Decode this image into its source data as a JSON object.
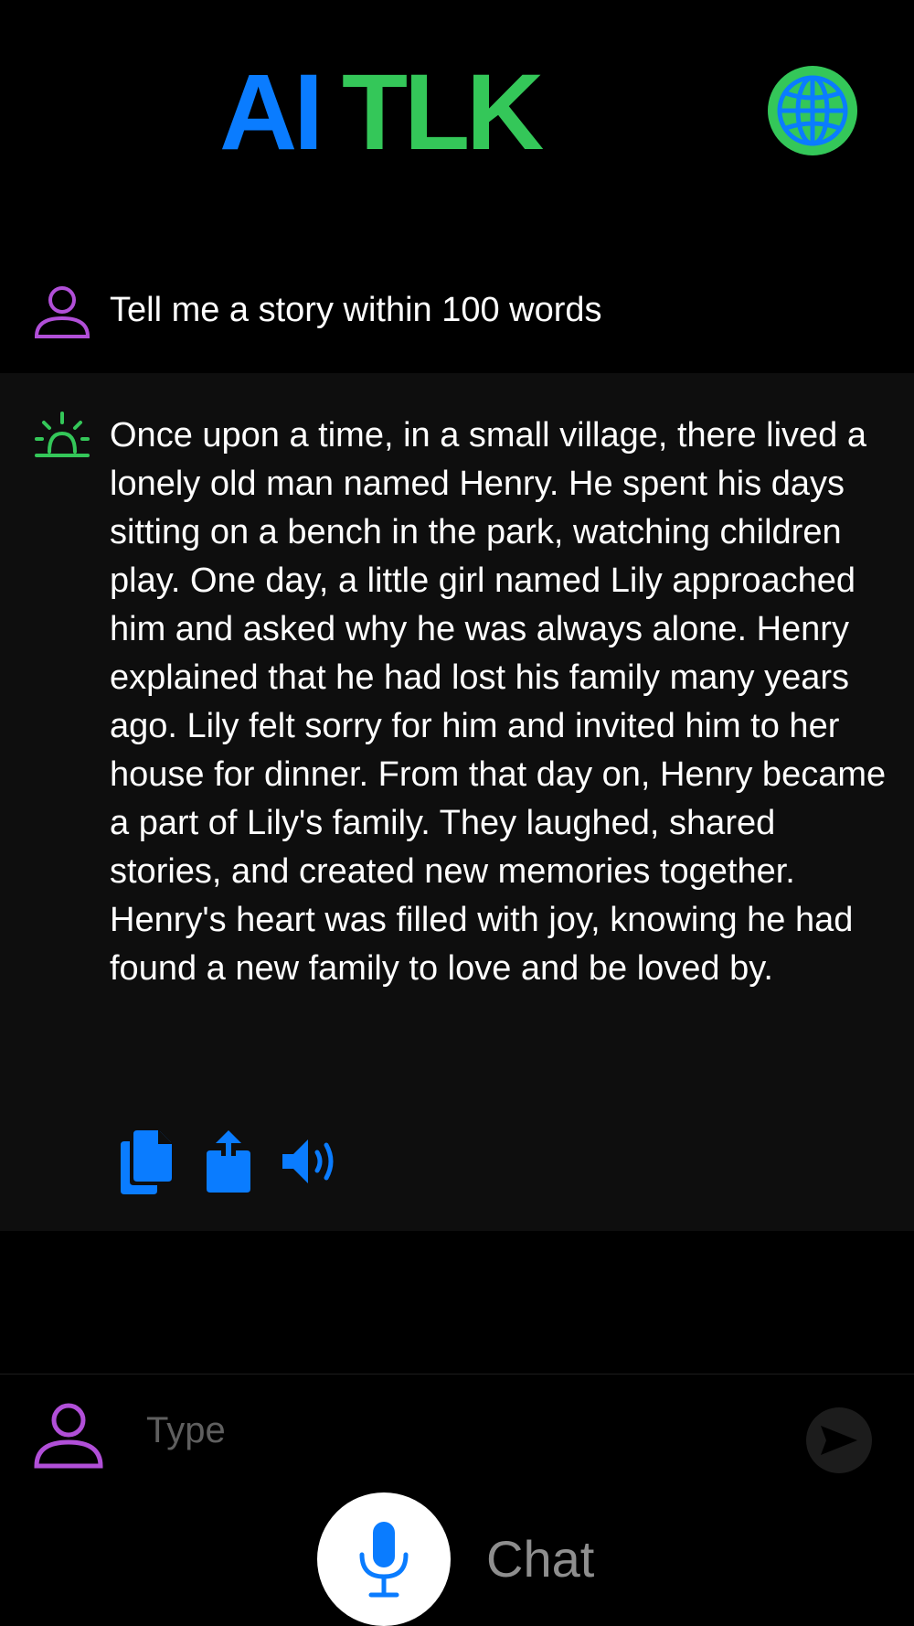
{
  "header": {
    "title_ai": "AI",
    "title_tlk": "TLK",
    "language_icon": "globe-icon"
  },
  "conversation": {
    "user_message": {
      "icon": "person-icon",
      "text": "Tell me a story within 100 words"
    },
    "assistant_message": {
      "icon": "sunrise-icon",
      "text": "Once upon a time, in a small village, there lived a lonely old man named Henry. He spent his days sitting on a bench in the park, watching children play. One day, a little girl named Lily approached him and asked why he was always alone. Henry explained that he had lost his family many years ago. Lily felt sorry for him and invited him to her house for dinner. From that day on, Henry became a part of Lily's family. They laughed, shared stories, and created new memories together. Henry's heart was filled with joy, knowing he had found a new family to love and be loved by.",
      "actions": [
        "copy-icon",
        "share-icon",
        "speaker-icon"
      ]
    }
  },
  "composer": {
    "avatar_icon": "person-icon",
    "placeholder": "Type",
    "send_icon": "send-icon"
  },
  "footer": {
    "mic_icon": "microphone-icon",
    "mode_label": "Chat"
  },
  "colors": {
    "blue": "#0a7cff",
    "green": "#34c759",
    "purple": "#b14fd8",
    "background": "#000000",
    "panel": "#0e0e0e"
  }
}
